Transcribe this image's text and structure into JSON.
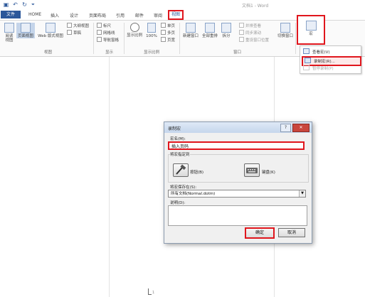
{
  "window": {
    "title": "文档1 - Word",
    "quick_access": [
      "save-icon",
      "undo-icon",
      "redo-icon",
      "customize-icon"
    ]
  },
  "tabs": [
    {
      "label": "文件"
    },
    {
      "label": "HOME"
    },
    {
      "label": "插入"
    },
    {
      "label": "设计"
    },
    {
      "label": "页面布局"
    },
    {
      "label": "引用"
    },
    {
      "label": "邮件"
    },
    {
      "label": "审阅"
    },
    {
      "label": "视图"
    }
  ],
  "ribbon": {
    "views_group": {
      "label": "视图",
      "read_mode": "阅读\n视图",
      "print_layout": "页面视图",
      "web_layout": "Web 版式视图",
      "outline": "大纲视图",
      "draft": "草稿"
    },
    "show_group": {
      "label": "显示",
      "ruler": "标尺",
      "gridlines": "网格线",
      "nav_pane": "导航窗格"
    },
    "zoom_group": {
      "label": "显示比例",
      "zoom": "显示比例",
      "hundred": "100%",
      "one_page": "单页",
      "multi_page": "多页",
      "page_width": "页宽"
    },
    "window_group": {
      "label": "窗口",
      "new_window": "新建窗口",
      "arrange_all": "全部重排",
      "split": "拆分",
      "side_by_side": "并排查看",
      "sync_scroll": "同步滚动",
      "reset_pos": "重设窗口位置",
      "switch_windows": "切换窗口"
    },
    "macros_group": {
      "label": "宏"
    }
  },
  "macro_menu": {
    "view_macros": "查看宏(V)",
    "record_macro": "录制宏(R)...",
    "pause_recording": "暂停录制(P)"
  },
  "dialog": {
    "title": "录制宏",
    "help": "?",
    "close": "✕",
    "macro_name_label": "宏名(M):",
    "macro_name_value": "插入页码",
    "assign_label": "将宏指定到",
    "button_option": "按钮(B)",
    "keyboard_option": "键盘(K)",
    "store_label": "将宏保存在(S):",
    "store_value": "所有文档(Normal.dotm)",
    "description_label": "说明(D):",
    "description_value": "",
    "ok": "确定",
    "cancel": "取消"
  },
  "document": {
    "page_number_mark": "1"
  },
  "colors": {
    "accent": "#2b579a",
    "highlight": "#e0161d"
  }
}
